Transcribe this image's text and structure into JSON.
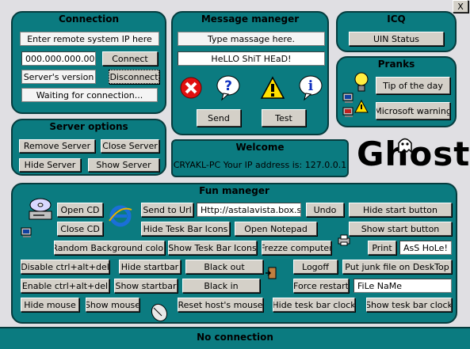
{
  "window": {
    "close_glyph": "X"
  },
  "connection": {
    "title": "Connection",
    "ip_prompt": "Enter remote system IP here",
    "ip_value": "000.000.000.000",
    "connect_label": "Connect",
    "server_version": "Server's version",
    "disconnect_label": "Disconnect",
    "status": "Waiting for connection..."
  },
  "message": {
    "title": "Message maneger",
    "prompt": "Type massage here.",
    "text_value": "HeLLO ShiT HEaD!",
    "send_label": "Send",
    "test_label": "Test",
    "icons": [
      "error-icon",
      "question-icon",
      "warning-icon",
      "info-icon"
    ]
  },
  "icq": {
    "title": "ICQ",
    "uin_label": "UIN Status"
  },
  "pranks": {
    "title": "Pranks",
    "tip_label": "Tip of the day",
    "ms_warning_label": "Microsoft warning"
  },
  "server_options": {
    "title": "Server options",
    "remove": "Remove Server",
    "close": "Close Server",
    "hide": "Hide Server",
    "show": "Show Server"
  },
  "welcome": {
    "title": "Welcome",
    "text": "CRYAKL-PC Your IP address is: 127.0.0.1"
  },
  "logo": {
    "text": "Ghost"
  },
  "fun": {
    "title": "Fun maneger",
    "open_cd": "Open CD",
    "close_cd": "Close CD",
    "send_to_url": "Send to Url",
    "url_value": "Http://astalavista.box.sk",
    "undo": "Undo",
    "hide_start_button": "Hide start button",
    "hide_task_bar_icons": "Hide Tesk Bar Icons",
    "open_notepad": "Open Notepad",
    "show_start_button": "Show start button",
    "random_bg": "Random Background color",
    "show_task_bar_icons": "Show Tesk Bar Icons",
    "freeze": "Frezze computer",
    "print": "Print",
    "print_value": "AsS HoLe!",
    "disable_cad": "Disable ctrl+alt+del",
    "hide_startbar": "Hide startbar",
    "black_out": "Black out",
    "logoff": "Logoff",
    "junk_file": "Put junk file on DeskTop",
    "enable_cad": "Enable ctrl+alt+del",
    "show_startbar": "Show startbar",
    "black_in": "Black in",
    "force_restart": "Force restart",
    "file_name_value": "FiLe NaMe",
    "hide_mouse": "Hide mouse",
    "show_mouse": "Show mouse",
    "reset_mouse": "Reset host's mouse",
    "hide_clock": "Hide tesk bar clock",
    "show_clock": "Show tesk bar clock"
  },
  "status_bar": {
    "text": "No connection"
  },
  "colors": {
    "panel": "#0b7b80",
    "background": "#e0dfe3"
  }
}
